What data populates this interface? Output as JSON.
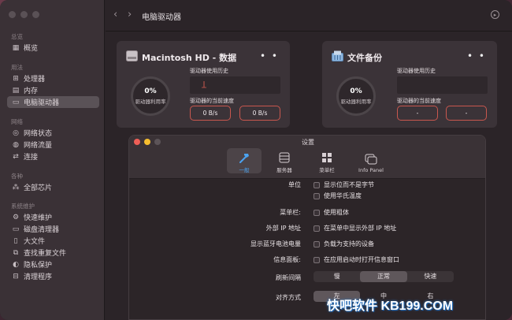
{
  "sidebar": {
    "sections": [
      {
        "title": "总览",
        "items": [
          {
            "label": "概览",
            "icon": "overview-icon"
          }
        ]
      },
      {
        "title": "用法",
        "items": [
          {
            "label": "处理器",
            "icon": "cpu-icon"
          },
          {
            "label": "内存",
            "icon": "memory-icon"
          },
          {
            "label": "电脑驱动器",
            "icon": "drive-icon"
          }
        ]
      },
      {
        "title": "网络",
        "items": [
          {
            "label": "网络状态",
            "icon": "network-status-icon"
          },
          {
            "label": "网络流量",
            "icon": "network-traffic-icon"
          },
          {
            "label": "连接",
            "icon": "connection-icon"
          }
        ]
      },
      {
        "title": "各种",
        "items": [
          {
            "label": "全部芯片",
            "icon": "chip-icon"
          }
        ]
      },
      {
        "title": "系统维护",
        "items": [
          {
            "label": "快速维护",
            "icon": "quick-maintain-icon"
          },
          {
            "label": "磁盘清理器",
            "icon": "disk-cleaner-icon"
          },
          {
            "label": "大文件",
            "icon": "large-files-icon"
          },
          {
            "label": "查找重复文件",
            "icon": "duplicate-icon"
          },
          {
            "label": "隐私保护",
            "icon": "privacy-icon"
          },
          {
            "label": "清理程序",
            "icon": "cleanup-icon"
          }
        ]
      }
    ],
    "active": "电脑驱动器"
  },
  "header": {
    "title": "电脑驱动器"
  },
  "cards": [
    {
      "title": "Macintosh HD - 数据",
      "percent": "0%",
      "ring_label": "驱动器利用率",
      "history_label": "驱动器使用历史",
      "speed_label": "驱动器的当前速度",
      "read": "0 B/s",
      "write": "0 B/s",
      "usage": 0
    },
    {
      "title": "文件备份",
      "percent": "0%",
      "ring_label": "驱动器利用率",
      "history_label": "驱动器使用历史",
      "speed_label": "驱动器的当前速度",
      "read": "-",
      "write": "-",
      "usage": 0
    }
  ],
  "dialog": {
    "title": "设置",
    "tabs": [
      "一般",
      "服务器",
      "菜单栏",
      "Info Panel"
    ],
    "active_tab": "一般",
    "rows": [
      {
        "label": "单位",
        "options": [
          "显示位而不是字节",
          "使用华氏温度"
        ]
      },
      {
        "label": "菜单栏:",
        "options": [
          "使用粗体"
        ]
      },
      {
        "label": "外部 IP 地址",
        "options": [
          "在菜单中显示外部 IP 地址"
        ]
      },
      {
        "label": "显示蓝牙电池电量",
        "options": [
          "负载为支持的设备"
        ]
      },
      {
        "label": "信息面板:",
        "options": [
          "在应用启动时打开信息窗口"
        ]
      }
    ],
    "refresh": {
      "label": "刷新间隔",
      "options": [
        "慢",
        "正常",
        "快速"
      ],
      "selected": "正常"
    },
    "alignment": {
      "label": "对齐方式",
      "options": [
        "左",
        "中",
        "右"
      ]
    }
  },
  "watermark": "快吧软件 KB199.COM",
  "colors": {
    "accent_blue": "#4ba3f0",
    "button_border": "#c9574e"
  }
}
